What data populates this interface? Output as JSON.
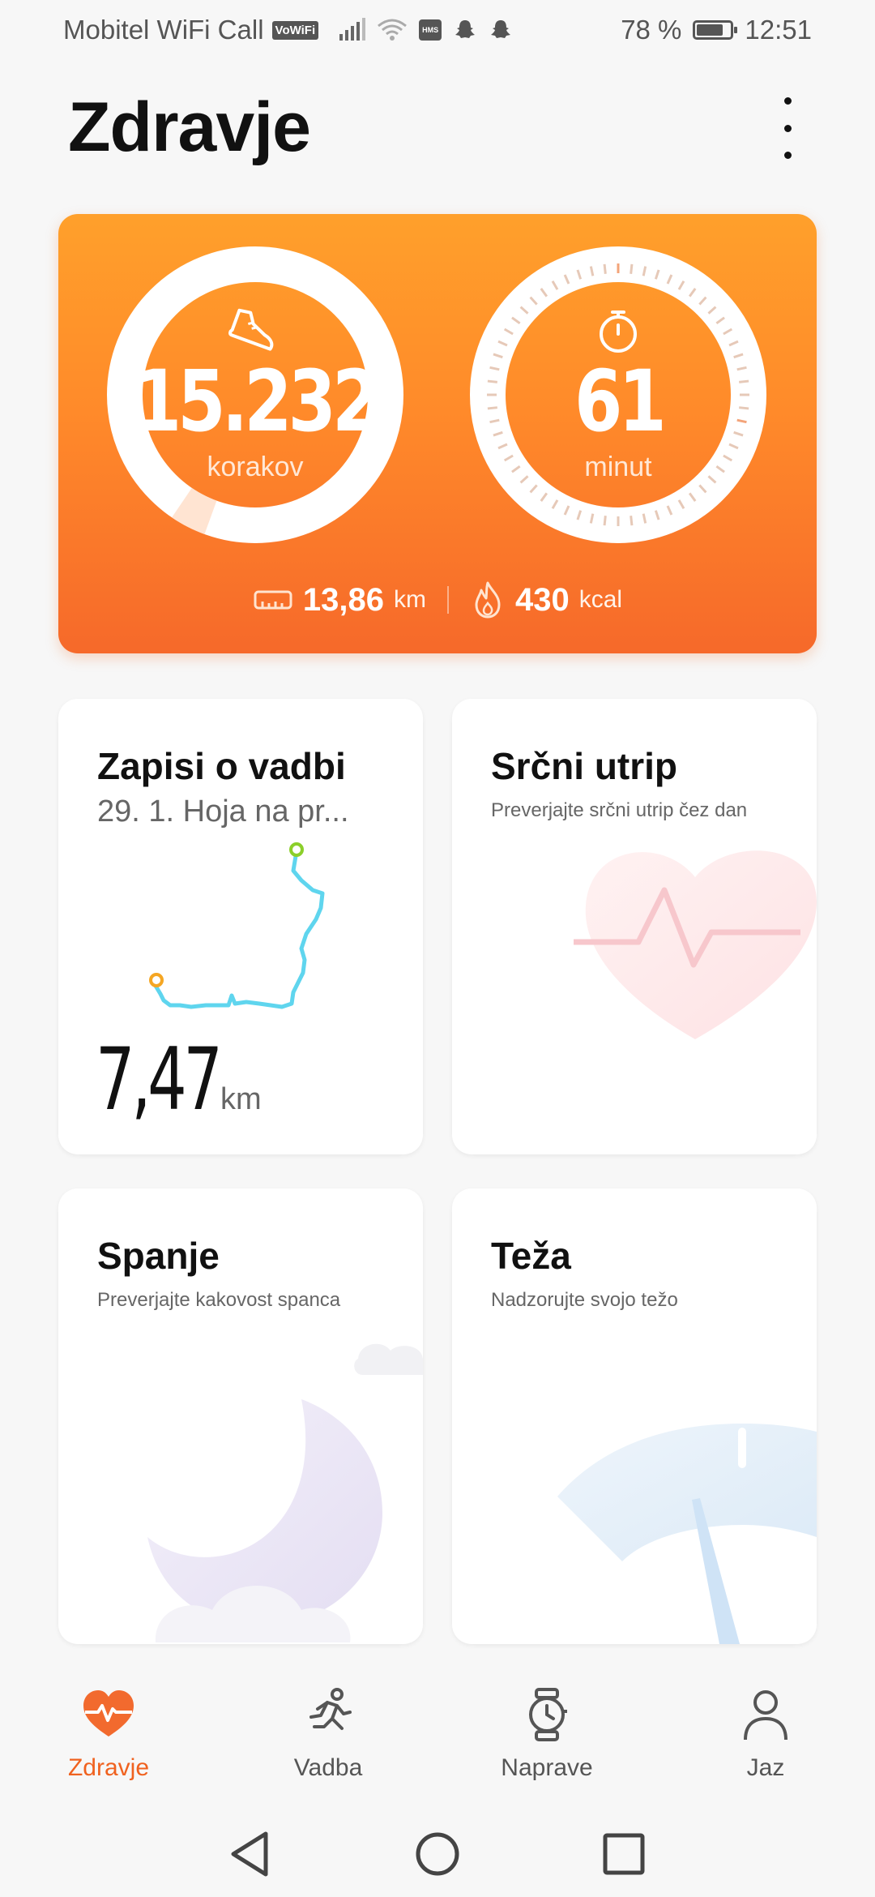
{
  "status_bar": {
    "carrier": "Mobitel WiFi Call",
    "vowifi_badge": "VoWiFi",
    "hms_badge": "HMS",
    "battery": "78 %",
    "battery_level": 0.78,
    "time": "12:51"
  },
  "header": {
    "title": "Zdravje",
    "menu_icon": "more-vertical-icon"
  },
  "activity": {
    "steps_value": "15.232",
    "steps_unit": "korakov",
    "steps_icon": "shoe-icon",
    "minutes_value": "61",
    "minutes_unit": "minut",
    "minutes_icon": "stopwatch-icon",
    "distance_value": "13,86",
    "distance_unit": "km",
    "calories_value": "430",
    "calories_unit": "kcal",
    "colors": {
      "gradient_top": "#ffa02b",
      "gradient_bottom": "#f6692a"
    }
  },
  "tiles": {
    "workout": {
      "title": "Zapisi o vadbi",
      "subtitle": "29. 1. Hoja na pr...",
      "distance": "7,47",
      "distance_unit": "km"
    },
    "heart": {
      "title": "Srčni utrip",
      "subtitle": "Preverjajte srčni utrip čez dan"
    },
    "sleep": {
      "title": "Spanje",
      "subtitle": "Preverjajte kakovost spanca"
    },
    "weight": {
      "title": "Teža",
      "subtitle": "Nadzorujte svojo težo"
    }
  },
  "bottom_nav": {
    "items": [
      {
        "label": "Zdravje",
        "icon": "heart-pulse-icon",
        "active": true
      },
      {
        "label": "Vadba",
        "icon": "running-icon",
        "active": false
      },
      {
        "label": "Naprave",
        "icon": "watch-icon",
        "active": false
      },
      {
        "label": "Jaz",
        "icon": "person-icon",
        "active": false
      }
    ],
    "active_color": "#f0621f"
  },
  "system_nav": {
    "back": "back-triangle-icon",
    "home": "home-circle-icon",
    "recents": "recents-square-icon"
  }
}
